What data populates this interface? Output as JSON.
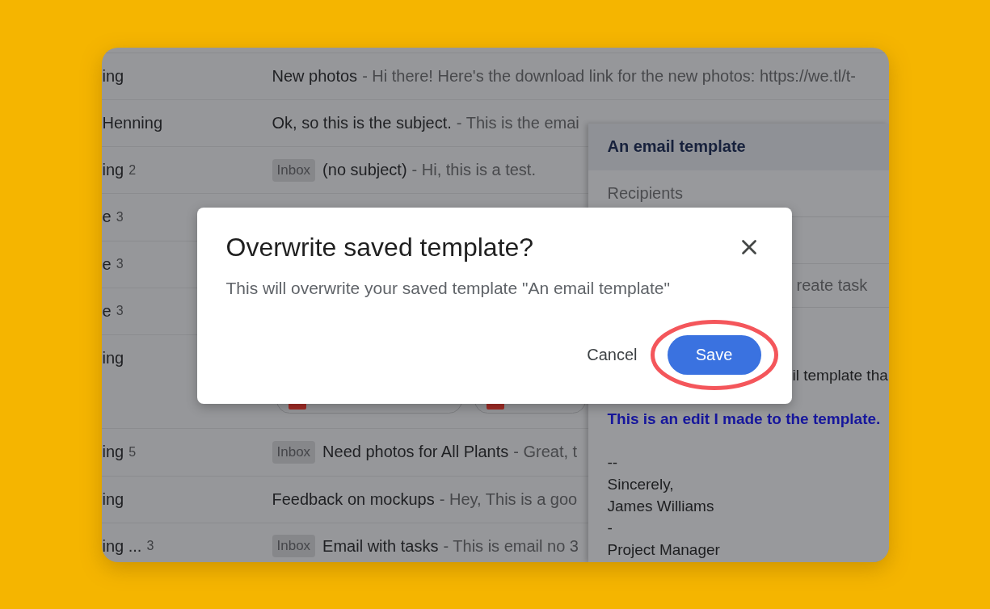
{
  "inbox": {
    "rows": [
      {
        "sender": "ing",
        "subject": "New photos",
        "snippet": "- Hi there! Here's the download link for the new photos: https://we.tl/t-"
      },
      {
        "sender": "Henning",
        "subject": "Ok, so this is the subject.",
        "snippet": "- This is the emai"
      },
      {
        "sender": "ing",
        "count": "2",
        "label": "Inbox",
        "subject": "(no subject)",
        "snippet": "- Hi, this is a test."
      },
      {
        "sender": "e",
        "count": "3"
      },
      {
        "sender": "e",
        "count": "3"
      },
      {
        "sender": "e",
        "count": "3"
      },
      {
        "sender": "ing",
        "attachments": [
          {
            "kind": "file"
          },
          {
            "kind": "file"
          }
        ]
      },
      {
        "sender": "ing",
        "count": "5",
        "label": "Inbox",
        "subject": "Need photos for All Plants",
        "snippet": "- Great, t"
      },
      {
        "sender": "ing",
        "subject": "Feedback on mockups",
        "snippet": "- Hey, This is a goo"
      },
      {
        "sender": "ing ...",
        "count": "3",
        "label": "Inbox",
        "subject": "Email with tasks",
        "snippet": "- This is email no 3"
      }
    ]
  },
  "template_window": {
    "title": "An email template",
    "recipients": {
      "placeholder": "Recipients"
    },
    "task_label": "reate task",
    "body": [
      {
        "kind": "fragment",
        "text": "il template tha"
      },
      {
        "kind": "edit",
        "text": "This is an edit I made to the template."
      },
      {
        "kind": "plain",
        "text": "--"
      },
      {
        "kind": "plain",
        "text": "Sincerely,"
      },
      {
        "kind": "plain",
        "text": "James Williams"
      },
      {
        "kind": "plain",
        "text": "-"
      },
      {
        "kind": "plain",
        "text": "Project Manager"
      }
    ]
  },
  "dialog": {
    "title": "Overwrite saved template?",
    "message": "This will overwrite your saved template \"An email template\"",
    "buttons": [
      {
        "label": "Cancel",
        "kind": "text",
        "highlighted": false
      },
      {
        "label": "Save",
        "kind": "primary",
        "highlighted": true
      }
    ]
  }
}
